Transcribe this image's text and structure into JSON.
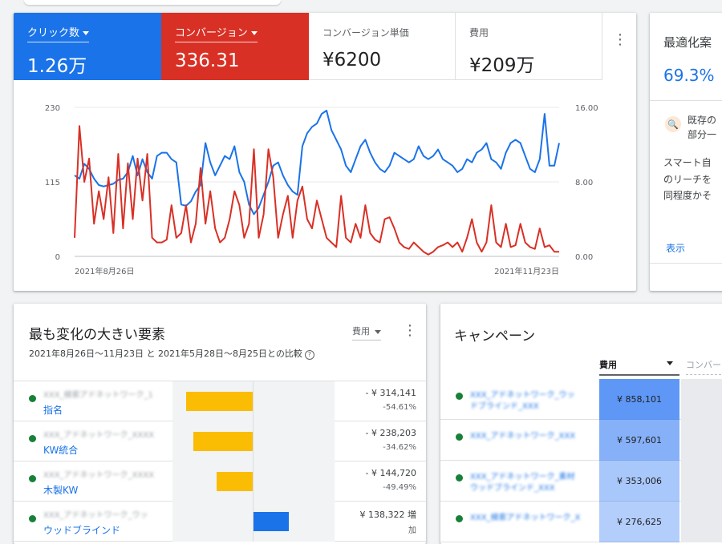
{
  "metrics": [
    {
      "label": "クリック数",
      "value": "1.26万",
      "selected": true,
      "color": "#1a73e8"
    },
    {
      "label": "コンバージョン",
      "value": "336.31",
      "selected": true,
      "color": "#d93025"
    },
    {
      "label": "コンバージョン単価",
      "value": "¥6200",
      "selected": false
    },
    {
      "label": "費用",
      "value": "¥209万",
      "selected": false
    }
  ],
  "chart_data": {
    "type": "line",
    "x_start_label": "2021年8月26日",
    "x_end_label": "2021年11月23日",
    "left_axis": {
      "ticks": [
        "230",
        "115",
        "0"
      ],
      "ylim": [
        0,
        230
      ]
    },
    "right_axis": {
      "ticks": [
        "16.00",
        "8.00",
        "0.00"
      ],
      "ylim": [
        0,
        16
      ]
    },
    "series": [
      {
        "name": "クリック数",
        "color": "#1a73e8",
        "axis": "left",
        "values": [
          125,
          120,
          143,
          135,
          120,
          110,
          108,
          110,
          112,
          118,
          120,
          130,
          155,
          125,
          150,
          130,
          120,
          155,
          160,
          160,
          150,
          145,
          80,
          78,
          85,
          100,
          110,
          175,
          145,
          125,
          140,
          155,
          150,
          170,
          130,
          115,
          80,
          65,
          75,
          95,
          115,
          140,
          145,
          125,
          110,
          100,
          95,
          170,
          190,
          200,
          205,
          220,
          225,
          195,
          180,
          165,
          140,
          130,
          150,
          170,
          180,
          160,
          145,
          135,
          130,
          140,
          160,
          155,
          150,
          145,
          150,
          170,
          155,
          150,
          155,
          165,
          150,
          145,
          140,
          130,
          135,
          150,
          145,
          160,
          165,
          175,
          150,
          145,
          135,
          160,
          175,
          180,
          175,
          155,
          135,
          130,
          150,
          220,
          140,
          140,
          175
        ]
      },
      {
        "name": "コンバージョン",
        "color": "#d93025",
        "axis": "right",
        "values": [
          2.0,
          14.0,
          8.0,
          10.5,
          3.5,
          7.0,
          4.0,
          8.5,
          2.5,
          11.0,
          3.0,
          10.0,
          4.0,
          10.5,
          6.0,
          11.0,
          2.0,
          1.5,
          1.5,
          1.8,
          5.5,
          2.0,
          2.5,
          5.5,
          1.5,
          3.5,
          9.5,
          3.5,
          7.0,
          3.0,
          1.5,
          2.0,
          4.0,
          7.0,
          5.5,
          2.0,
          3.5,
          11.5,
          2.0,
          4.5,
          11.5,
          8.5,
          2.0,
          4.5,
          6.5,
          2.0,
          6.0,
          7.5,
          4.0,
          3.0,
          6.0,
          4.0,
          2.0,
          1.5,
          1.0,
          6.5,
          2.0,
          1.5,
          3.5,
          2.0,
          5.5,
          2.5,
          1.8,
          1.5,
          4.0,
          4.2,
          3.0,
          1.5,
          1.0,
          0.8,
          1.5,
          1.0,
          0.5,
          0.2,
          0.5,
          1.0,
          1.2,
          1.5,
          1.0,
          1.5,
          0.5,
          2.0,
          4.0,
          1.5,
          0.5,
          1.5,
          5.5,
          1.5,
          1.0,
          3.5,
          1.0,
          1.2,
          3.5,
          1.5,
          1.0,
          0.8,
          3.0,
          1.0,
          1.2,
          0.5,
          0.5
        ]
      }
    ]
  },
  "optimization": {
    "title": "最適化案",
    "value": "69.3%",
    "item1": "既存の",
    "item2": "部分一",
    "desc1": "スマート自",
    "desc2": "のリーチを",
    "desc3": "同程度かそ",
    "link": "表示"
  },
  "changes": {
    "title": "最も変化の大きい要素",
    "subtitle": "2021年8月26日～11月23日 と 2021年5月28日～8月25日との比較",
    "selector": "費用",
    "rows": [
      {
        "name": "指名",
        "blurred": "XXX_検索アドネットワーク_1",
        "value": "- ¥ 314,141",
        "pct": "-54.61%",
        "fraction": -0.83
      },
      {
        "name": "KW統合",
        "blurred": "XXX_アドネットワーク_XXXX",
        "value": "- ¥ 238,203",
        "pct": "-34.62%",
        "fraction": -0.74
      },
      {
        "name": "木製KW",
        "blurred": "XXX_アドネットワーク_XXXX",
        "value": "- ¥ 144,720",
        "pct": "-49.49%",
        "fraction": -0.45
      },
      {
        "name": "ウッドブラインド",
        "blurred": "XXX_アドネットワーク_ウッ",
        "value": "¥ 138,322 増",
        "pct": "加",
        "fraction": 0.44
      }
    ]
  },
  "campaigns": {
    "title": "キャンペーン",
    "col_active": "費用",
    "col_next": "コンバー",
    "rows": [
      {
        "blurred1": "XXX_アドネットワーク_ウッ",
        "blurred2": "ドブラインド_XXX",
        "cost": "¥ 858,101",
        "intensity": 1.0
      },
      {
        "blurred1": "XXX_アドネットワーク_XXX",
        "blurred2": "",
        "cost": "¥ 597,601",
        "intensity": 0.65
      },
      {
        "blurred1": "XXX_アドネットワーク_素材",
        "blurred2": "ウッドブラインド_XXX",
        "cost": "¥ 353,006",
        "intensity": 0.35
      },
      {
        "blurred1": "XXX_検索アドネットワーク_X",
        "blurred2": "",
        "cost": "¥ 276,625",
        "intensity": 0.25
      }
    ]
  }
}
